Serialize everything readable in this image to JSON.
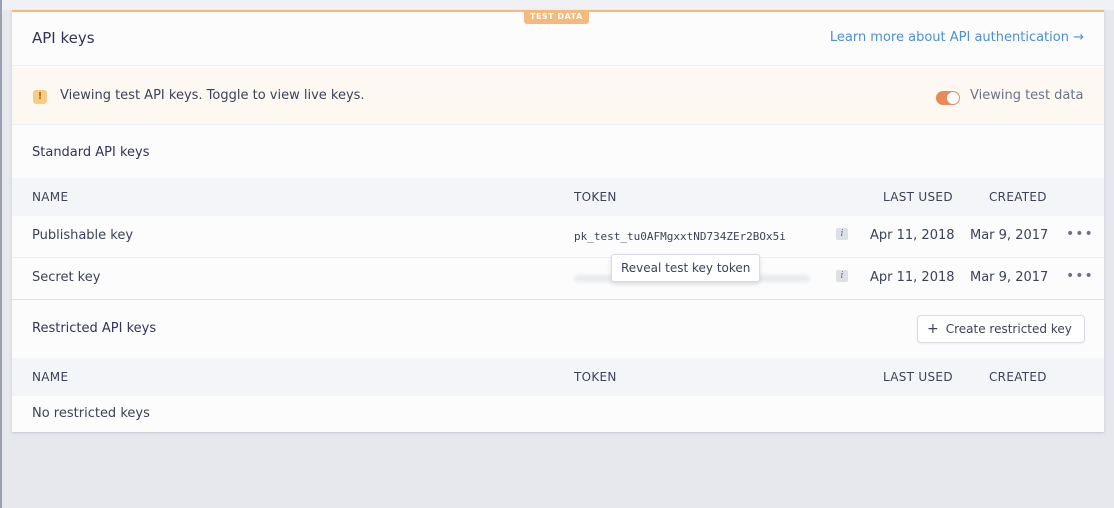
{
  "badge": "TEST DATA",
  "header": {
    "title": "API keys",
    "learn_link": "Learn more about API authentication →"
  },
  "notice": {
    "icon": "warning-icon",
    "text": "Viewing test API keys. Toggle to view live keys.",
    "toggle_label": "Viewing test data"
  },
  "standard": {
    "title": "Standard API keys",
    "columns": {
      "name": "NAME",
      "token": "TOKEN",
      "last_used": "LAST USED",
      "created": "CREATED"
    },
    "rows": [
      {
        "name": "Publishable key",
        "token": "pk_test_tu0AFMgxxtND734ZEr2BOx5i",
        "last_used": "Apr 11, 2018",
        "created": "Mar 9, 2017"
      },
      {
        "name": "Secret key",
        "token": "",
        "last_used": "Apr 11, 2018",
        "created": "Mar 9, 2017"
      }
    ],
    "reveal_tooltip": "Reveal test key token"
  },
  "restricted": {
    "title": "Restricted API keys",
    "create_button": "Create restricted key",
    "columns": {
      "name": "NAME",
      "token": "TOKEN",
      "last_used": "LAST USED",
      "created": "CREATED"
    },
    "empty_text": "No restricted keys"
  },
  "icons": {
    "info": "i",
    "more": "•••",
    "plus": "+",
    "warn": "!"
  },
  "colors": {
    "accent_test": "#f5b97b",
    "link": "#4b8fd6",
    "toggle": "#e88a5b"
  }
}
